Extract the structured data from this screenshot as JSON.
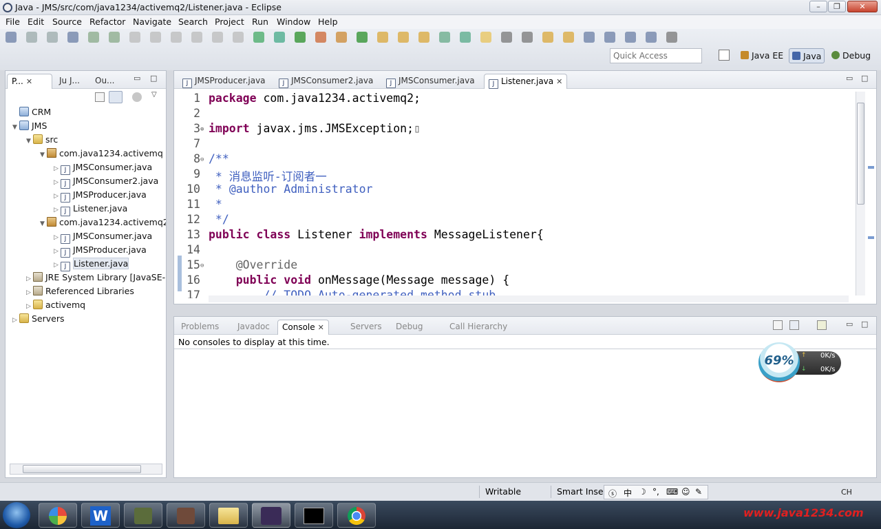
{
  "window": {
    "title": "Java - JMS/src/com/java1234/activemq2/Listener.java - Eclipse",
    "minimize": "–",
    "maximize": "❐",
    "close": "✕"
  },
  "menu": [
    "File",
    "Edit",
    "Source",
    "Refactor",
    "Navigate",
    "Search",
    "Project",
    "Run",
    "Window",
    "Help"
  ],
  "toolbar": {
    "quick_access_placeholder": "Quick Access",
    "perspectives": [
      "Java EE",
      "Java",
      "Debug"
    ]
  },
  "explorer": {
    "tabs": [
      "P...",
      "Ju J...",
      "Ou..."
    ],
    "tree": [
      {
        "label": "CRM",
        "icon": "project",
        "level": 0,
        "toggle": ""
      },
      {
        "label": "JMS",
        "icon": "project",
        "level": 0,
        "toggle": "▼"
      },
      {
        "label": "src",
        "icon": "source-folder",
        "level": 1,
        "toggle": "▼"
      },
      {
        "label": "com.java1234.activemq",
        "icon": "package",
        "level": 2,
        "toggle": "▼"
      },
      {
        "label": "JMSConsumer.java",
        "icon": "java-file",
        "level": 3,
        "toggle": "▷"
      },
      {
        "label": "JMSConsumer2.java",
        "icon": "java-file",
        "level": 3,
        "toggle": "▷"
      },
      {
        "label": "JMSProducer.java",
        "icon": "java-file",
        "level": 3,
        "toggle": "▷"
      },
      {
        "label": "Listener.java",
        "icon": "java-file",
        "level": 3,
        "toggle": "▷"
      },
      {
        "label": "com.java1234.activemq2",
        "icon": "package",
        "level": 2,
        "toggle": "▼"
      },
      {
        "label": "JMSConsumer.java",
        "icon": "java-file",
        "level": 3,
        "toggle": "▷"
      },
      {
        "label": "JMSProducer.java",
        "icon": "java-file",
        "level": 3,
        "toggle": "▷"
      },
      {
        "label": "Listener.java",
        "icon": "java-file",
        "level": 3,
        "toggle": "▷"
      },
      {
        "label": "JRE System Library [JavaSE-",
        "icon": "library",
        "level": 1,
        "toggle": "▷"
      },
      {
        "label": "Referenced Libraries",
        "icon": "library",
        "level": 1,
        "toggle": "▷"
      },
      {
        "label": "activemq",
        "icon": "folder",
        "level": 1,
        "toggle": "▷"
      },
      {
        "label": "Servers",
        "icon": "folder",
        "level": 0,
        "toggle": "▷"
      }
    ]
  },
  "editor": {
    "tabs": [
      "JMSProducer.java",
      "JMSConsumer2.java",
      "JMSConsumer.java",
      "Listener.java"
    ],
    "lines": [
      {
        "n": "1",
        "parts": [
          {
            "t": "package",
            "c": "kw"
          },
          {
            "t": " com.java1234.activemq2;",
            "c": ""
          }
        ]
      },
      {
        "n": "2",
        "parts": []
      },
      {
        "n": "3",
        "fold": "⊕",
        "parts": [
          {
            "t": "import",
            "c": "kw"
          },
          {
            "t": " javax.jms.JMSException;",
            "c": ""
          },
          {
            "t": "▯",
            "c": "ann"
          }
        ]
      },
      {
        "n": "7",
        "parts": []
      },
      {
        "n": "8",
        "fold": "⊖",
        "parts": [
          {
            "t": "/**",
            "c": "cm"
          }
        ]
      },
      {
        "n": "9",
        "parts": [
          {
            "t": " * 消息监听-订阅者一",
            "c": "cm"
          }
        ]
      },
      {
        "n": "10",
        "parts": [
          {
            "t": " * ",
            "c": "cm"
          },
          {
            "t": "@author",
            "c": "cm"
          },
          {
            "t": " Administrator",
            "c": "cm"
          }
        ]
      },
      {
        "n": "11",
        "parts": [
          {
            "t": " *",
            "c": "cm"
          }
        ]
      },
      {
        "n": "12",
        "parts": [
          {
            "t": " */",
            "c": "cm"
          }
        ]
      },
      {
        "n": "13",
        "parts": [
          {
            "t": "public",
            "c": "kw"
          },
          {
            "t": " ",
            "c": ""
          },
          {
            "t": "class",
            "c": "kw"
          },
          {
            "t": " Listener ",
            "c": ""
          },
          {
            "t": "implements",
            "c": "kw"
          },
          {
            "t": " MessageListener{",
            "c": ""
          }
        ]
      },
      {
        "n": "14",
        "parts": []
      },
      {
        "n": "15",
        "fold": "⊖",
        "parts": [
          {
            "t": "    @Override",
            "c": "ann"
          }
        ]
      },
      {
        "n": "16",
        "parts": [
          {
            "t": "    ",
            "c": ""
          },
          {
            "t": "public",
            "c": "kw"
          },
          {
            "t": " ",
            "c": ""
          },
          {
            "t": "void",
            "c": "kw"
          },
          {
            "t": " onMessage(Message message) {",
            "c": ""
          }
        ]
      },
      {
        "n": "17",
        "parts": [
          {
            "t": "        // TODO Auto-generated method stub",
            "c": "cm"
          }
        ]
      }
    ]
  },
  "console": {
    "tabs": [
      "Problems",
      "Javadoc",
      "Console",
      "Servers",
      "Debug",
      "Call Hierarchy"
    ],
    "message": "No consoles to display at this time."
  },
  "net_widget": {
    "percent": "69%",
    "up": "0K/s",
    "down": "0K/s"
  },
  "status": {
    "writable": "Writable",
    "insert_mode": "Smart Inser"
  },
  "taskbar": {
    "watermark": "www.java1234.com",
    "ime": "CH"
  }
}
